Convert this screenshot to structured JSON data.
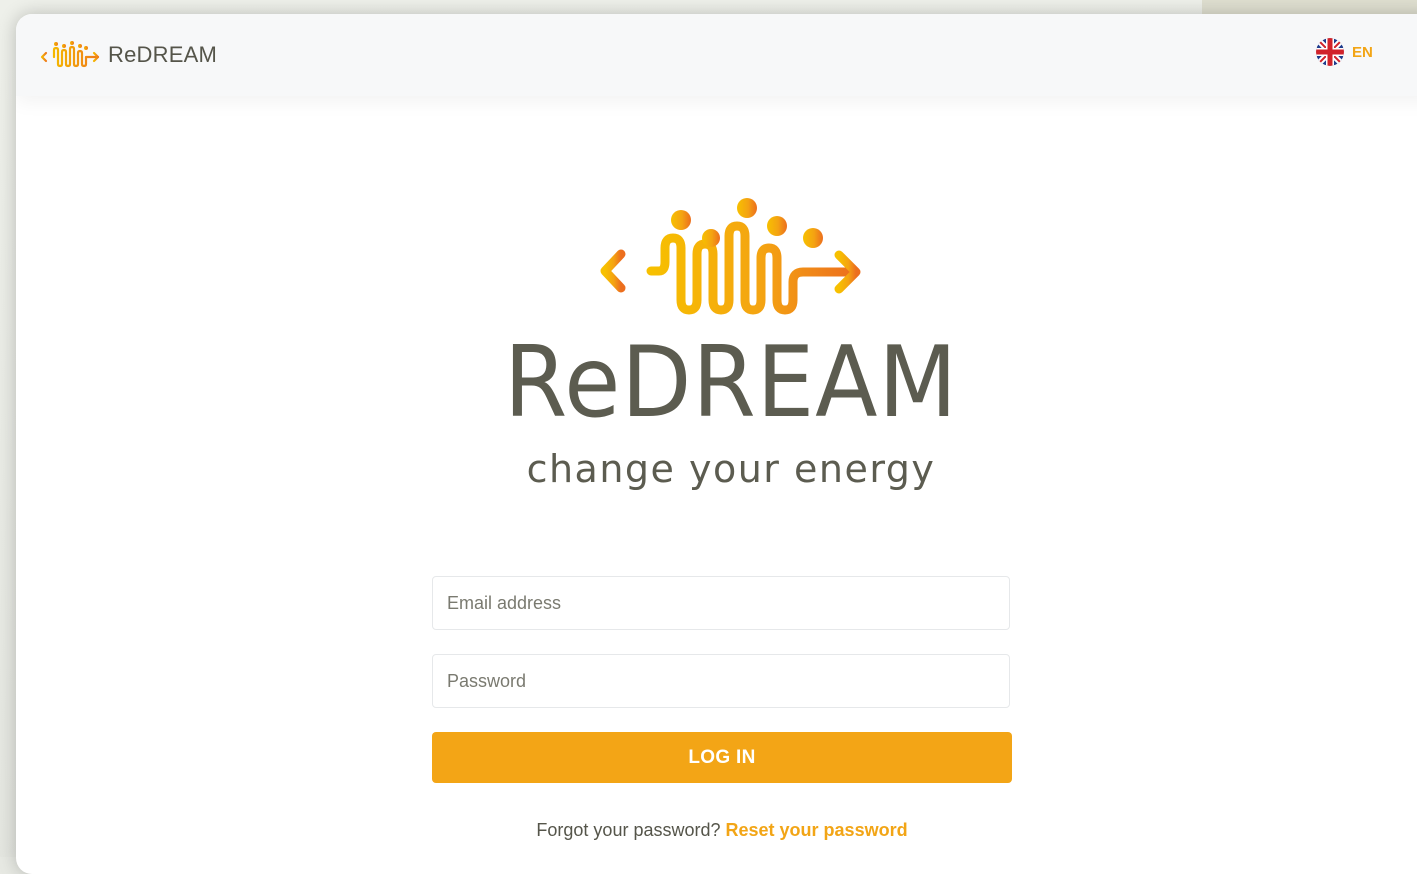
{
  "header": {
    "brand_name": "ReDREAM",
    "language_code": "EN",
    "language_flag": "uk-flag-icon"
  },
  "hero": {
    "title": "ReDREAM",
    "tagline": "change your energy"
  },
  "form": {
    "email_placeholder": "Email address",
    "password_placeholder": "Password",
    "login_label": "LOG IN",
    "forgot_text": "Forgot your password?",
    "reset_link": "Reset your password"
  },
  "colors": {
    "accent": "#f3a516",
    "logo_yellow": "#f5b800",
    "logo_orange": "#ee7a1c",
    "text_dark": "#5c5c50"
  }
}
